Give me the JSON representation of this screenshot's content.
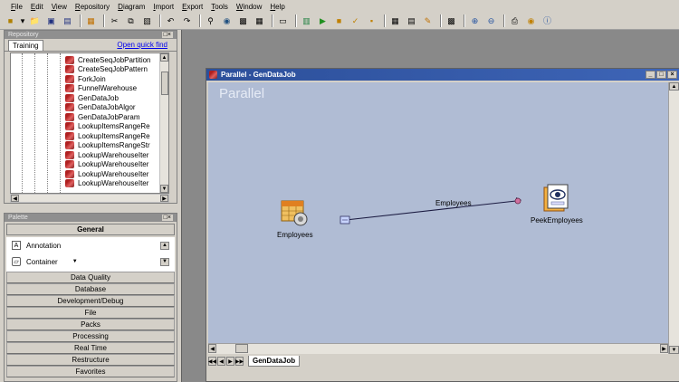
{
  "menu": [
    "File",
    "Edit",
    "View",
    "Repository",
    "Diagram",
    "Import",
    "Export",
    "Tools",
    "Window",
    "Help"
  ],
  "repository": {
    "title": "Repository",
    "tab": "Training",
    "quick_find": "Open quick find",
    "items": [
      "CreateSeqJobPartition",
      "CreateSeqJobPattern",
      "ForkJoin",
      "FunnelWarehouse",
      "GenDataJob",
      "GenDataJobAlgor",
      "GenDataJobParam",
      "LookupItemsRangeRe",
      "LookupItemsRangeRe",
      "LookupItemsRangeStr",
      "LookupWarehouseIter",
      "LookupWarehouseIter",
      "LookupWarehouseIter",
      "LookupWarehouseIter"
    ]
  },
  "palette": {
    "title": "Palette",
    "general": "General",
    "annotation": "Annotation",
    "container": "Container",
    "categories": [
      "Data Quality",
      "Database",
      "Development/Debug",
      "File",
      "Packs",
      "Processing",
      "Real Time",
      "Restructure",
      "Favorites"
    ]
  },
  "job_window": {
    "title": "Parallel - GenDataJob",
    "watermark": "Parallel",
    "stage_source": "Employees",
    "link_label": "Employees",
    "stage_target": "PeekEmployees",
    "tab": "GenDataJob"
  },
  "colors": {
    "canvas": "#b0bcd4",
    "titlebar": "#2c4f9a",
    "link": "#1a1a40"
  }
}
